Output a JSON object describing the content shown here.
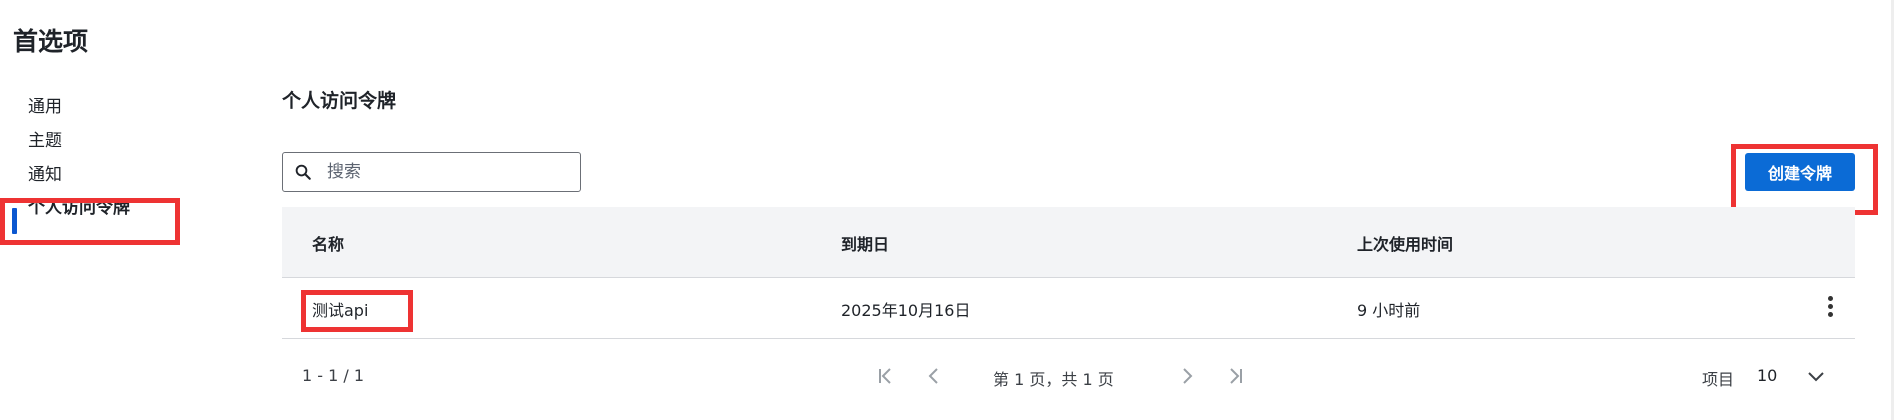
{
  "page": {
    "title": "首选项"
  },
  "sidebar": {
    "items": [
      {
        "label": "通用"
      },
      {
        "label": "主题"
      },
      {
        "label": "通知"
      },
      {
        "label": "个人访问令牌",
        "active": true
      }
    ]
  },
  "section": {
    "title": "个人访问令牌"
  },
  "search": {
    "placeholder": "搜索",
    "value": "",
    "icon": "search-icon"
  },
  "toolbar": {
    "create_label": "创建令牌"
  },
  "table": {
    "columns": [
      "名称",
      "到期日",
      "上次使用时间"
    ],
    "rows": [
      {
        "name": "测试api",
        "expires": "2025年10月16日",
        "last_used": "9 小时前"
      }
    ]
  },
  "pagination": {
    "range": "1 - 1 / 1",
    "page_info": "第 1 页，共 1 页",
    "per_page_label": "项目",
    "per_page_value": "10"
  },
  "colors": {
    "primary": "#0b6bd6",
    "highlight": "#ee3333",
    "header_bg": "#f3f4f6"
  }
}
